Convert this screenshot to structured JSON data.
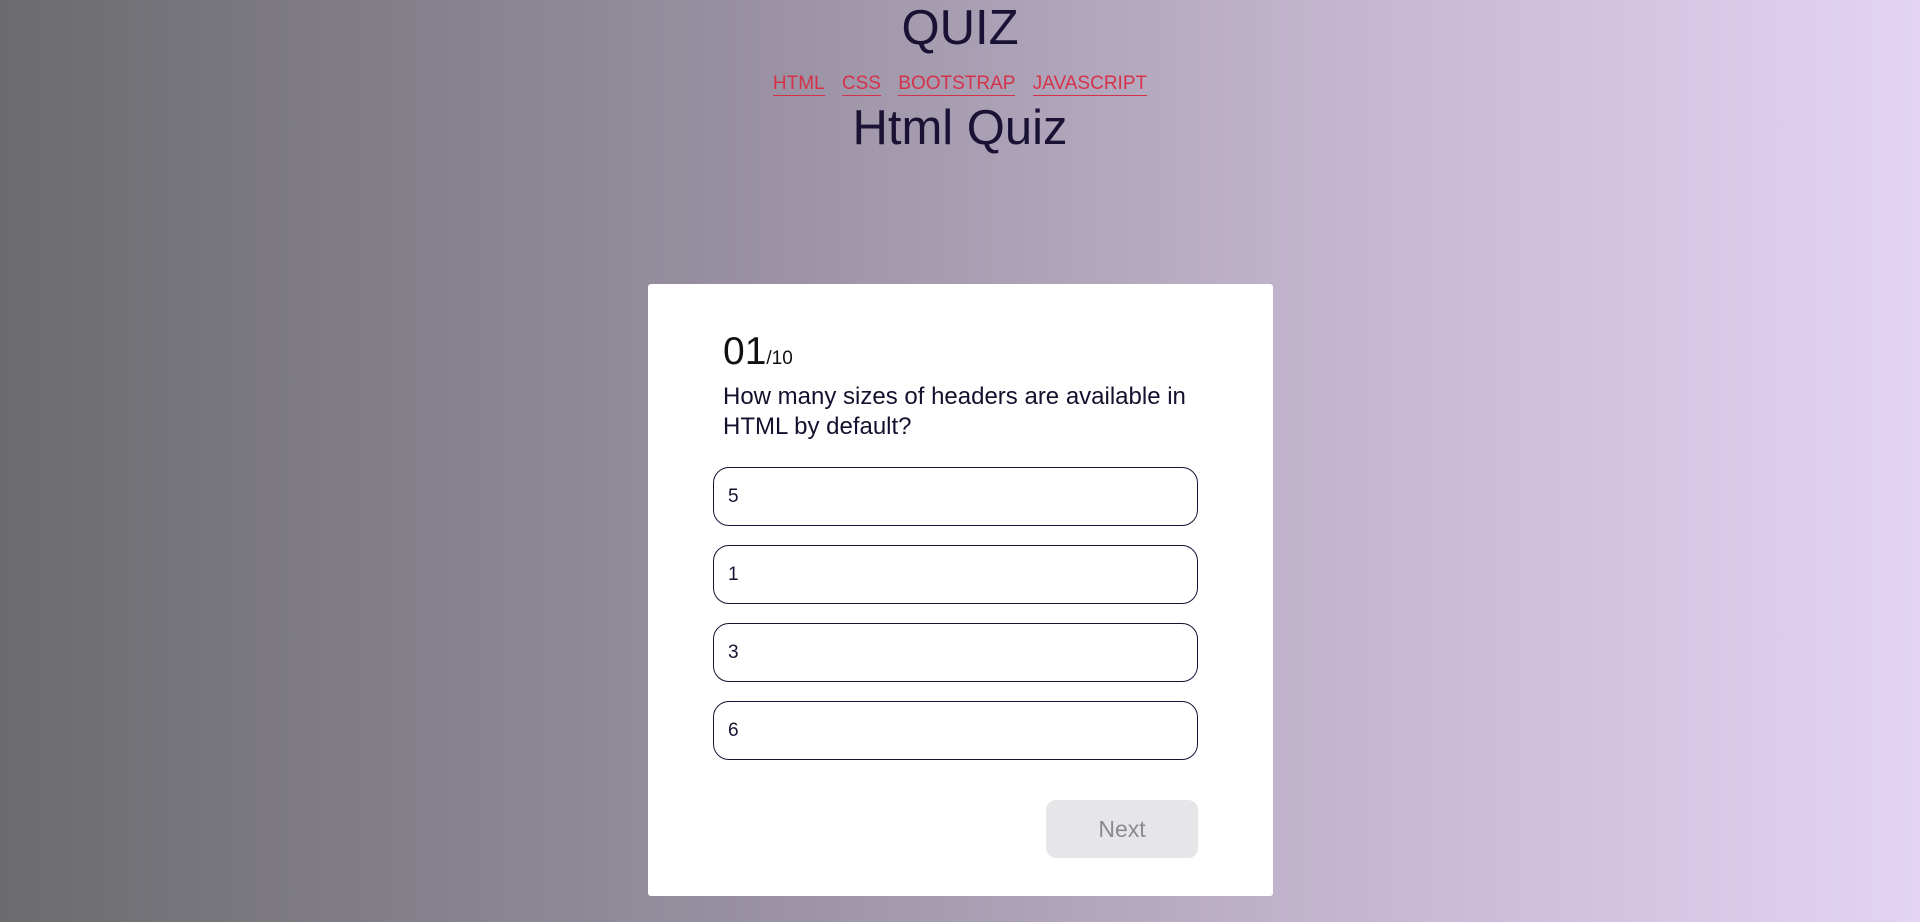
{
  "header": {
    "site_title": "QUIZ",
    "nav": [
      {
        "label": "HTML"
      },
      {
        "label": "CSS"
      },
      {
        "label": "BOOTSTRAP"
      },
      {
        "label": "JAVASCRIPT"
      }
    ],
    "quiz_title": "Html Quiz"
  },
  "quiz": {
    "current": "01",
    "total": "/10",
    "question": "How many sizes of headers are available in HTML by default?",
    "options": [
      {
        "label": "5"
      },
      {
        "label": "1"
      },
      {
        "label": "3"
      },
      {
        "label": "6"
      }
    ],
    "next_label": "Next"
  },
  "colors": {
    "nav_link": "#d6314a",
    "heading": "#1a1234",
    "next_button_bg": "#e6e6e9",
    "next_button_text": "#8a8a8f"
  }
}
